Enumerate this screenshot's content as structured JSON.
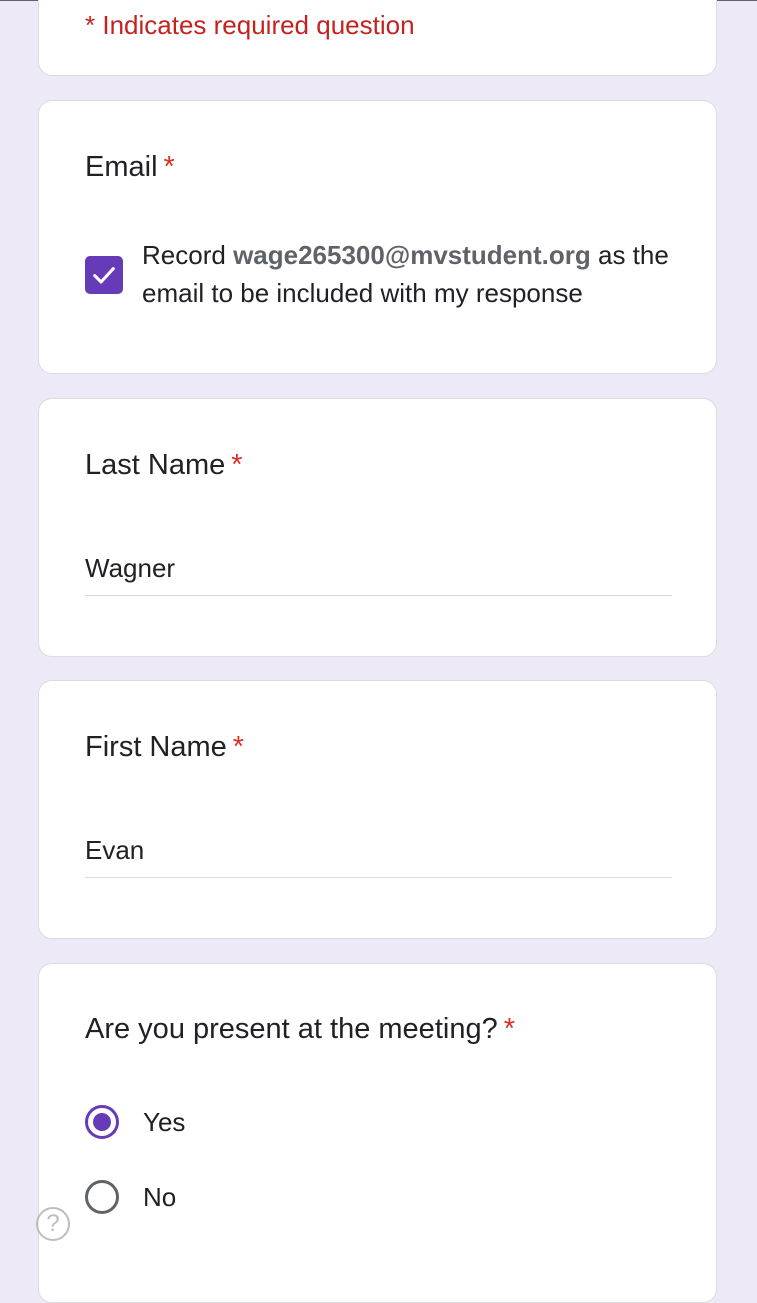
{
  "form": {
    "required_note": "* Indicates required question",
    "required_mark": "*",
    "email_question": {
      "title": "Email",
      "checked": true,
      "prefix": "Record",
      "email": "wage265300@mvstudent.org",
      "suffix": "as the email to be included with my response"
    },
    "last_name_question": {
      "title": "Last Name",
      "value": "Wagner"
    },
    "first_name_question": {
      "title": "First Name",
      "value": "Evan"
    },
    "present_question": {
      "title": "Are you present at the meeting?",
      "options": [
        {
          "label": "Yes",
          "selected": true
        },
        {
          "label": "No",
          "selected": false
        }
      ]
    }
  },
  "help": {
    "icon": "help-icon",
    "glyph": "?"
  },
  "colors": {
    "accent": "#673ab7",
    "required": "#d93025",
    "background": "#ede9f7"
  }
}
